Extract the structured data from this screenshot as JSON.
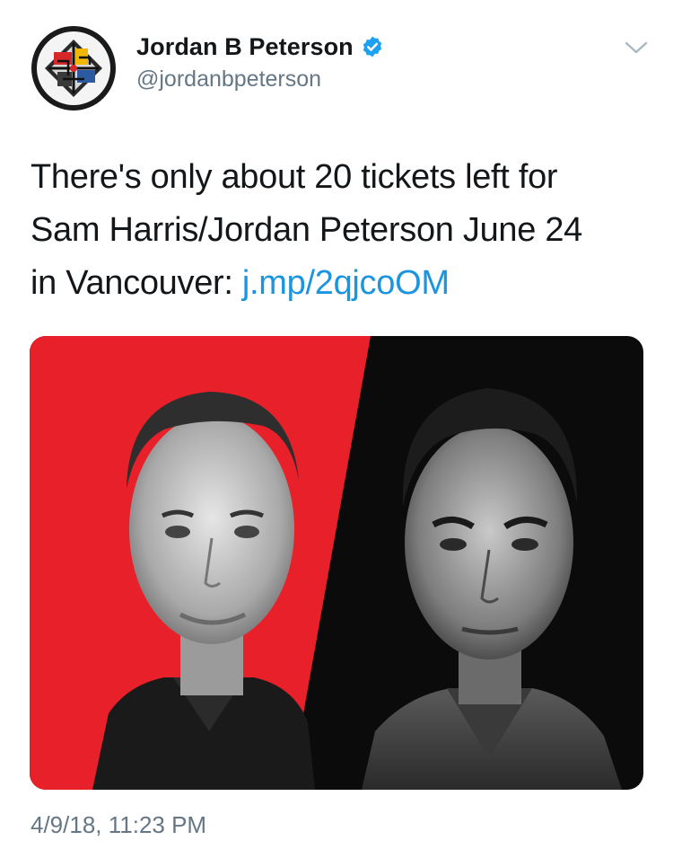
{
  "tweet": {
    "author": {
      "display_name": "Jordan B Peterson",
      "handle": "@jordanbpeterson",
      "verified": true,
      "avatar_icon": "maze-logo-avatar"
    },
    "text_lines": [
      "There's only about 20 tickets left for",
      "Sam Harris/Jordan Peterson June 24",
      "in Vancouver: "
    ],
    "link_text": "j.mp/2qjcoOM",
    "timestamp": "4/9/18, 11:23 PM",
    "media": {
      "description_icon": "two-portraits-photo",
      "colors": {
        "left_background": "#e8202a",
        "right_background": "#0b0b0b"
      }
    },
    "menu_icon": "chevron-down-icon"
  },
  "colors": {
    "text": "#14171a",
    "secondary": "#657786",
    "link": "#1b95e0",
    "verified_badge": "#1da1f2"
  }
}
